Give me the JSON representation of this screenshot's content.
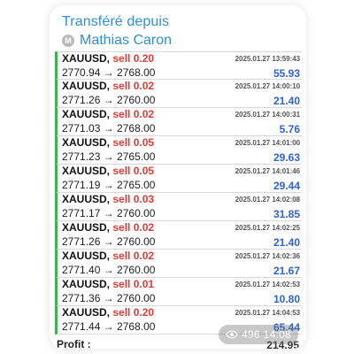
{
  "forward": {
    "title": "Transféré depuis",
    "author": "Mathias Caron",
    "avatar_initial": "M"
  },
  "trades": [
    {
      "symbol": "XAUUSD,",
      "side": "sell 0.20",
      "price": "2770.94 → 2768.00",
      "time": "2025.01.27 13:59:43",
      "profit": "55.93"
    },
    {
      "symbol": "XAUUSD,",
      "side": "sell 0.02",
      "price": "2771.26 → 2760.00",
      "time": "2025.01.27 14:00:10",
      "profit": "21.40"
    },
    {
      "symbol": "XAUUSD,",
      "side": "sell 0.02",
      "price": "2771.03 → 2768.00",
      "time": "2025.01.27 14:00:31",
      "profit": "5.76"
    },
    {
      "symbol": "XAUUSD,",
      "side": "sell 0.05",
      "price": "2771.23 → 2765.00",
      "time": "2025.01.27 14:01:00",
      "profit": "29.63"
    },
    {
      "symbol": "XAUUSD,",
      "side": "sell 0.05",
      "price": "2771.19 → 2765.00",
      "time": "2025.01.27 14:01:46",
      "profit": "29.44"
    },
    {
      "symbol": "XAUUSD,",
      "side": "sell 0.03",
      "price": "2771.17 → 2760.00",
      "time": "2025.01.27 14:02:08",
      "profit": "31.85"
    },
    {
      "symbol": "XAUUSD,",
      "side": "sell 0.02",
      "price": "2771.26 → 2760.00",
      "time": "2025.01.27 14:02:25",
      "profit": "21.40"
    },
    {
      "symbol": "XAUUSD,",
      "side": "sell 0.02",
      "price": "2771.40 → 2760.00",
      "time": "2025.01.27 14:02:36",
      "profit": "21.67"
    },
    {
      "symbol": "XAUUSD,",
      "side": "sell 0.01",
      "price": "2771.36 → 2760.00",
      "time": "2025.01.27 14:02:53",
      "profit": "10.80"
    },
    {
      "symbol": "XAUUSD,",
      "side": "sell 0.20",
      "price": "2771.44 → 2768.00",
      "time": "2025.01.27 14:04:53",
      "profit": "65.44"
    }
  ],
  "footer": {
    "label": "Profit :",
    "total": "214.95"
  },
  "views": {
    "count": "496",
    "time": "14:08",
    "icon": "eye-icon"
  },
  "colors": {
    "accent": "#2f8fdc",
    "sell": "#e33b35",
    "profit": "#2d62d8",
    "row_marker": "#3cb34a"
  }
}
